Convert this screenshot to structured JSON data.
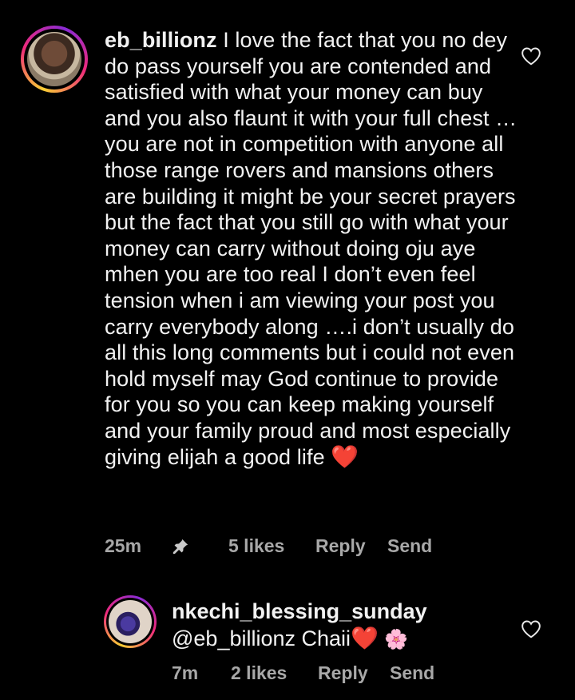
{
  "comments": [
    {
      "username": "eb_billionz",
      "text": "I love the fact that you no dey do pass yourself you are contended and satisfied with what your money can buy and you also flaunt it with your full chest …you are not in competition with anyone all those range rovers and mansions others are building it might be your secret prayers but the fact that you still go with what your money can carry without doing oju aye mhen you are too real I don’t even feel tension when i am viewing your post you carry everybody along ….i don’t usually do all this long comments but i could not even hold myself may God continue to provide for you so you can keep making yourself and your family proud and most especially giving elijah a good life",
      "emoji": "❤️",
      "time": "25m",
      "likes": "5 likes",
      "reply_label": "Reply",
      "send_label": "Send",
      "pinned": true,
      "avatar_icon": "profile-photo",
      "like_icon": "heart-outline-icon"
    },
    {
      "username": "nkechi_blessing_sunday",
      "text": "@eb_billionz Chaii",
      "emoji_heart": "❤️",
      "emoji_flower": "🌸",
      "time": "7m",
      "likes": "2 likes",
      "reply_label": "Reply",
      "send_label": "Send",
      "avatar_icon": "profile-photo",
      "like_icon": "heart-outline-icon"
    }
  ],
  "colors": {
    "background": "#000000",
    "text": "#f2f2f2",
    "meta": "#a8a8a8",
    "heart": "#e8253a"
  }
}
